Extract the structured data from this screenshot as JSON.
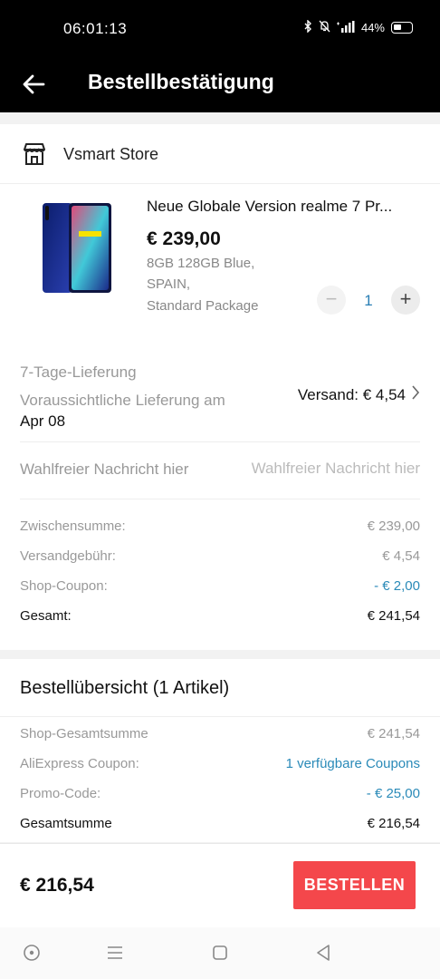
{
  "status_bar": {
    "time": "06:01:13",
    "battery": "44%"
  },
  "header": {
    "title": "Bestellbestätigung"
  },
  "store": {
    "name": "Vsmart Store"
  },
  "product": {
    "title": "Neue Globale Version realme 7 Pr...",
    "price": "€ 239,00",
    "variant_lines": [
      "8GB 128GB Blue,",
      "SPAIN,",
      "Standard Package"
    ],
    "quantity": "1",
    "qty_minus": "−",
    "qty_plus": "+"
  },
  "delivery": {
    "label": "7-Tage-Lieferung",
    "estimate_label": "Voraussichtliche Lieferung am",
    "estimate_date": "Apr 08",
    "shipping": "Versand: € 4,54"
  },
  "message": {
    "label": "Wahlfreier Nachricht hier",
    "placeholder": "Wahlfreier Nachricht hier"
  },
  "summary": [
    {
      "label": "Zwischensumme:",
      "value": "€ 239,00"
    },
    {
      "label": "Versandgebühr:",
      "value": "€ 4,54"
    },
    {
      "label": "Shop-Coupon:",
      "value": "- € 2,00"
    },
    {
      "label": "Gesamt:",
      "value": "€ 241,54"
    }
  ],
  "overview": {
    "title": "Bestellübersicht (1 Artikel)",
    "rows": [
      {
        "label": "Shop-Gesamtsumme",
        "value": "€ 241,54"
      },
      {
        "label": "AliExpress Coupon:",
        "value": "1 verfügbare Coupons"
      },
      {
        "label": "Promo-Code:",
        "value": "- € 25,00"
      },
      {
        "label": "Gesamtsumme",
        "value": "€ 216,54"
      }
    ]
  },
  "footer": {
    "total": "€ 216,54",
    "order_button": "BESTELLEN"
  },
  "colors": {
    "accent_red": "#f4474b",
    "link_blue": "#2a8ab8",
    "header_bg": "#000000"
  }
}
